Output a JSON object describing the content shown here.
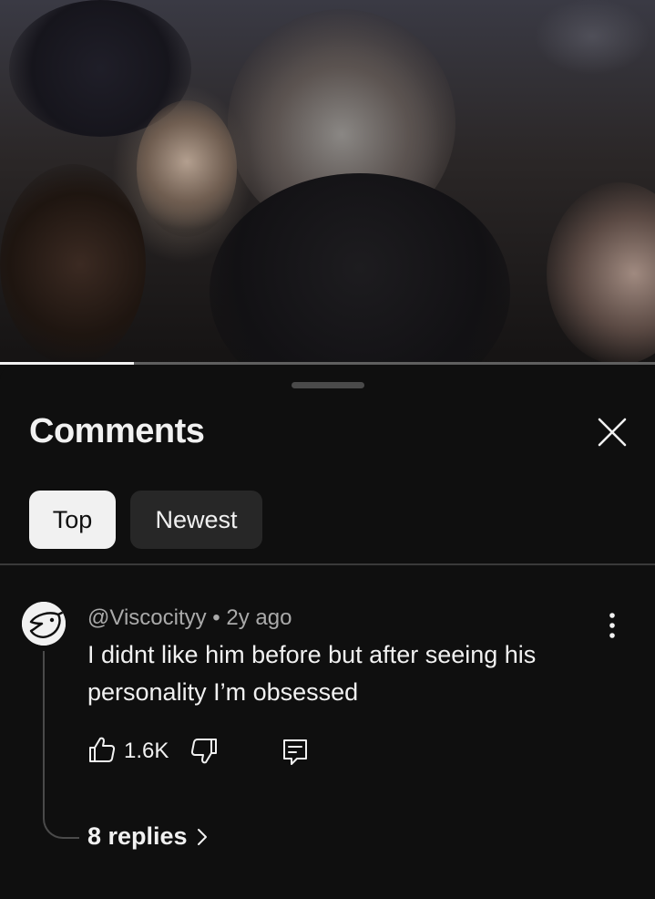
{
  "video": {
    "progress_fraction": 0.204
  },
  "comments_sheet": {
    "title": "Comments",
    "close_icon": "close-icon",
    "filters": [
      {
        "label": "Top",
        "selected": true
      },
      {
        "label": "Newest",
        "selected": false
      }
    ]
  },
  "comment": {
    "handle": "@Viscocityy",
    "separator": "•",
    "time": "2y ago",
    "text": "I didnt like him before but after seeing his personality I’m obsessed",
    "like_count": "1.6K",
    "replies_label": "8 replies",
    "icons": {
      "like": "thumbs-up-icon",
      "dislike": "thumbs-down-icon",
      "reply": "reply-icon",
      "more": "more-vertical-icon",
      "chevron": "chevron-right-icon"
    }
  },
  "colors": {
    "background": "#0f0f0f",
    "text_primary": "#f1f1f1",
    "text_secondary": "#aaaaaa",
    "chip_selected_bg": "#f1f1f1",
    "chip_unselected_bg": "#272727"
  }
}
